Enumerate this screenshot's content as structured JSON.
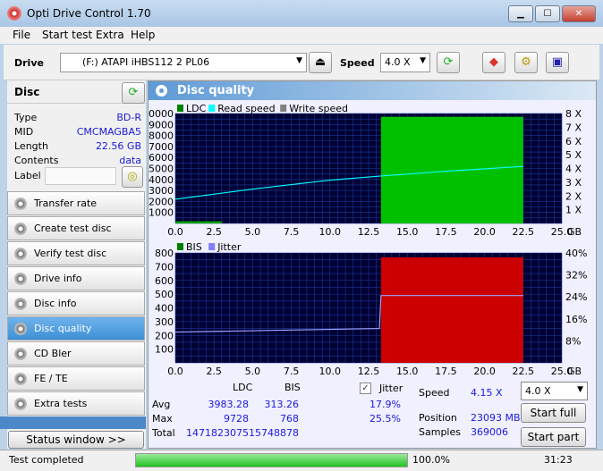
{
  "window": {
    "title": "Opti Drive Control 1.70",
    "minimize": "▁",
    "maximize": "☐",
    "close": "✕"
  },
  "menu": [
    "File",
    "Start test",
    "Extra",
    "Help"
  ],
  "toolbar": {
    "drive_label": "Drive",
    "drive_value": "(F:)  ATAPI iHBS112  2 PL06",
    "speed_label": "Speed",
    "speed_value": "4.0 X"
  },
  "disc": {
    "header": "Disc",
    "rows": [
      {
        "k": "Type",
        "v": "BD-R"
      },
      {
        "k": "MID",
        "v": "CMCMAGBA5"
      },
      {
        "k": "Length",
        "v": "22.56 GB"
      },
      {
        "k": "Contents",
        "v": "data"
      }
    ],
    "label_label": "Label",
    "label_value": ""
  },
  "nav": [
    "Transfer rate",
    "Create test disc",
    "Verify test disc",
    "Drive info",
    "Disc info",
    "Disc quality",
    "CD Bler",
    "FE / TE",
    "Extra tests"
  ],
  "nav_selected": "Disc quality",
  "status_window": "Status window >>",
  "panel_title": "Disc quality",
  "chart_data": [
    {
      "type": "bar",
      "legend": [
        "LDC",
        "Read speed",
        "Write speed"
      ],
      "legend_colors": [
        "#008000",
        "#00ffff",
        "#808080"
      ],
      "xlim": [
        0,
        25
      ],
      "ylim": [
        0,
        10000
      ],
      "y2lim": [
        0,
        8
      ],
      "xticks": [
        "0.0",
        "2.5",
        "5.0",
        "7.5",
        "10.0",
        "12.5",
        "15.0",
        "17.5",
        "20.0",
        "22.5",
        "25.0"
      ],
      "xunit": "GB",
      "yticks": [
        "1000",
        "2000",
        "3000",
        "4000",
        "5000",
        "6000",
        "7000",
        "8000",
        "9000",
        "10000"
      ],
      "y2ticks": [
        "1 X",
        "2 X",
        "3 X",
        "4 X",
        "5 X",
        "6 X",
        "7 X",
        "8 X"
      ],
      "ldc_block": {
        "x": [
          13.3,
          22.5
        ],
        "value": 9700,
        "color": "#00c000"
      },
      "ldc_early": {
        "x": [
          0,
          13.3
        ],
        "value": 200
      },
      "read_speed": {
        "x": [
          0,
          5,
          10,
          13.3,
          17.5,
          22.5
        ],
        "y": [
          1.76,
          2.5,
          3.15,
          3.45,
          3.8,
          4.15
        ]
      }
    },
    {
      "type": "bar",
      "legend": [
        "BIS",
        "Jitter"
      ],
      "legend_colors": [
        "#008000",
        "#8080ff"
      ],
      "xlim": [
        0,
        25
      ],
      "ylim": [
        0,
        800
      ],
      "y2lim": [
        0,
        40
      ],
      "xticks": [
        "0.0",
        "2.5",
        "5.0",
        "7.5",
        "10.0",
        "12.5",
        "15.0",
        "17.5",
        "20.0",
        "22.5",
        "25.0"
      ],
      "xunit": "GB",
      "yticks": [
        "100",
        "200",
        "300",
        "400",
        "500",
        "600",
        "700",
        "800"
      ],
      "y2ticks": [
        "8%",
        "16%",
        "24%",
        "32%",
        "40%"
      ],
      "bis_block": {
        "x": [
          13.3,
          22.5
        ],
        "value": 768,
        "color": "#cc0000"
      },
      "jitter": {
        "x": [
          0,
          13.2,
          13.3,
          22.5
        ],
        "y": [
          11.2,
          12.5,
          24.5,
          24.5
        ]
      }
    }
  ],
  "stats": {
    "col_ldc": "LDC",
    "col_bis": "BIS",
    "jitter_label": "Jitter",
    "jitter_checked": true,
    "rows": [
      {
        "k": "Avg",
        "ldc": "3983.28",
        "bis": "313.26",
        "jit": "17.9%"
      },
      {
        "k": "Max",
        "ldc": "9728",
        "bis": "768",
        "jit": "25.5%"
      },
      {
        "k": "Total",
        "ldc": "1471823075",
        "bis": "15748878",
        "jit": ""
      }
    ],
    "speed_label": "Speed",
    "speed_value": "4.15 X",
    "position_label": "Position",
    "position_value": "23093 MB",
    "samples_label": "Samples",
    "samples_value": "369006",
    "speed_select": "4.0 X",
    "start_full": "Start full",
    "start_part": "Start part"
  },
  "statusbar": {
    "text": "Test completed",
    "progress": 100,
    "percent": "100.0%",
    "time": "31:23"
  }
}
